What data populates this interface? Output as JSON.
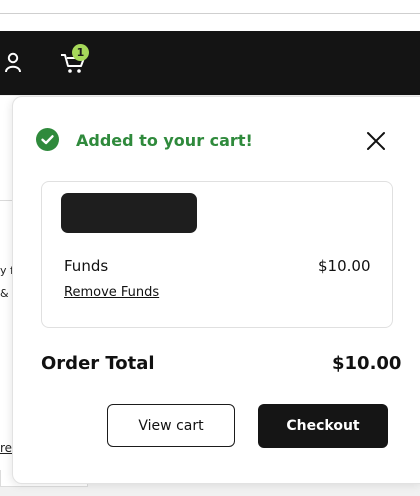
{
  "header": {
    "cart_count": "1"
  },
  "page_background": {
    "left_snippets": [
      "y fo",
      "&"
    ],
    "left_link": "re"
  },
  "cart_panel": {
    "added_message": "Added to your cart!",
    "item": {
      "name": "Funds",
      "price": "$10.00",
      "remove_label": "Remove Funds"
    },
    "order_total_label": "Order Total",
    "order_total_value": "$10.00",
    "view_cart_label": "View cart",
    "checkout_label": "Checkout"
  },
  "colors": {
    "header_bg": "#141414",
    "success_green": "#2f8a3c",
    "badge_green": "#a6d85a",
    "checkout_bg": "#151515"
  },
  "icons": [
    "account-icon",
    "cart-icon",
    "check-circle-icon",
    "close-icon"
  ]
}
